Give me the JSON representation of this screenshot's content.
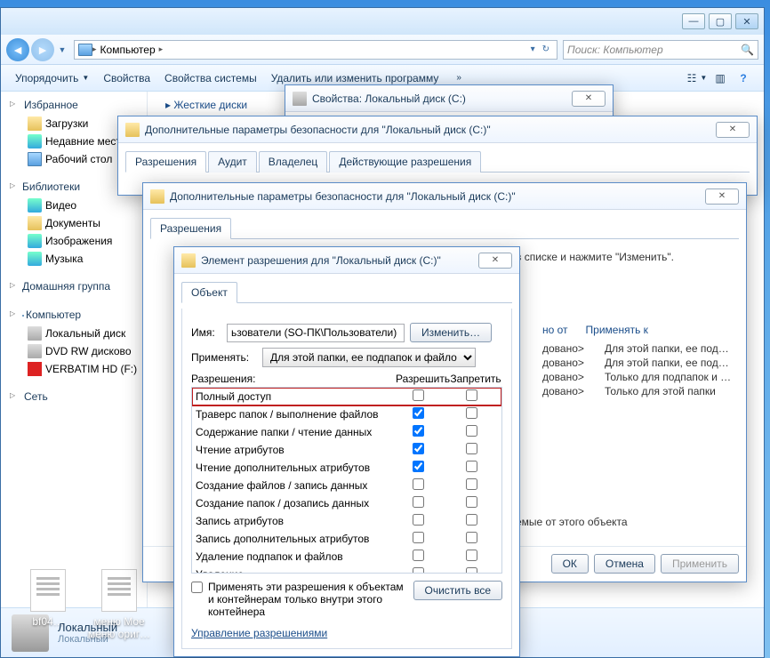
{
  "explorer": {
    "breadcrumb": [
      "Компьютер"
    ],
    "search_placeholder": "Поиск: Компьютер",
    "toolbar": {
      "organize": "Упорядочить",
      "props": "Свойства",
      "sysprops": "Свойства системы",
      "uninstall": "Удалить или изменить программу"
    },
    "sidebar": {
      "favorites": {
        "head": "Избранное",
        "items": [
          "Загрузки",
          "Недавние места",
          "Рабочий стол"
        ]
      },
      "libraries": {
        "head": "Библиотеки",
        "items": [
          "Видео",
          "Документы",
          "Изображения",
          "Музыка"
        ]
      },
      "homegroup": {
        "head": "Домашняя группа"
      },
      "computer": {
        "head": "Компьютер",
        "items": [
          "Локальный диск",
          "DVD RW дисковo",
          "VERBATIM HD (F:)"
        ]
      },
      "network": {
        "head": "Сеть"
      }
    },
    "main_link": "Жесткие диски",
    "details": {
      "title": "Локальный",
      "sub": "Локальный"
    }
  },
  "desktop_icons": [
    "bf04…",
    "меню Мое меню ориг…"
  ],
  "dlg_props": {
    "title": "Свойства: Локальный диск (C:)"
  },
  "dlg_adv1": {
    "title": "Дополнительные параметры безопасности для \"Локальный диск (C:)\"",
    "tabs": [
      "Разрешения",
      "Аудит",
      "Владелец",
      "Действующие разрешения"
    ]
  },
  "dlg_adv2": {
    "title": "Дополнительные параметры безопасности для \"Локальный диск (C:)\"",
    "tabs": [
      "Разрешения"
    ],
    "hint": "в списке и нажмите \"Изменить\".",
    "headers": [
      "но от",
      "Применять к"
    ],
    "rows": [
      {
        "c1": "довано>",
        "c2": "Для этой папки, ее под…"
      },
      {
        "c1": "довано>",
        "c2": "Для этой папки, ее под…"
      },
      {
        "c1": "довано>",
        "c2": "Только для подпапок и …"
      },
      {
        "c1": "довано>",
        "c2": "Только для этой папки"
      }
    ],
    "inherit_text": "емые от этого объекта",
    "footer": {
      "ok": "ОК",
      "cancel": "Отмена",
      "apply": "Применить"
    }
  },
  "dlg_entry": {
    "title": "Элемент разрешения для \"Локальный диск (C:)\"",
    "tabs": [
      "Объект"
    ],
    "name_label": "Имя:",
    "name_value": "ьзователи (SO-ПК\\Пользователи)",
    "change_btn": "Изменить…",
    "apply_label": "Применять:",
    "apply_value": "Для этой папки, ее подпапок и файлов",
    "perm_label": "Разрешения:",
    "allow_label": "Разрешить",
    "deny_label": "Запретить",
    "perms": [
      {
        "label": "Полный доступ",
        "allow": false,
        "deny": false,
        "highlight": true
      },
      {
        "label": "Траверс папок / выполнение файлов",
        "allow": true,
        "deny": false
      },
      {
        "label": "Содержание папки / чтение данных",
        "allow": true,
        "deny": false
      },
      {
        "label": "Чтение атрибутов",
        "allow": true,
        "deny": false
      },
      {
        "label": "Чтение дополнительных атрибутов",
        "allow": true,
        "deny": false
      },
      {
        "label": "Создание файлов / запись данных",
        "allow": false,
        "deny": false
      },
      {
        "label": "Создание папок / дозапись данных",
        "allow": false,
        "deny": false
      },
      {
        "label": "Запись атрибутов",
        "allow": false,
        "deny": false
      },
      {
        "label": "Запись дополнительных атрибутов",
        "allow": false,
        "deny": false
      },
      {
        "label": "Удаление подпапок и файлов",
        "allow": false,
        "deny": false
      },
      {
        "label": "Удаление",
        "allow": false,
        "deny": false
      }
    ],
    "container_apply": "Применять эти разрешения к объектам и контейнерам только внутри этого контейнера",
    "clear_btn": "Очистить все",
    "manage_link": "Управление разрешениями"
  }
}
